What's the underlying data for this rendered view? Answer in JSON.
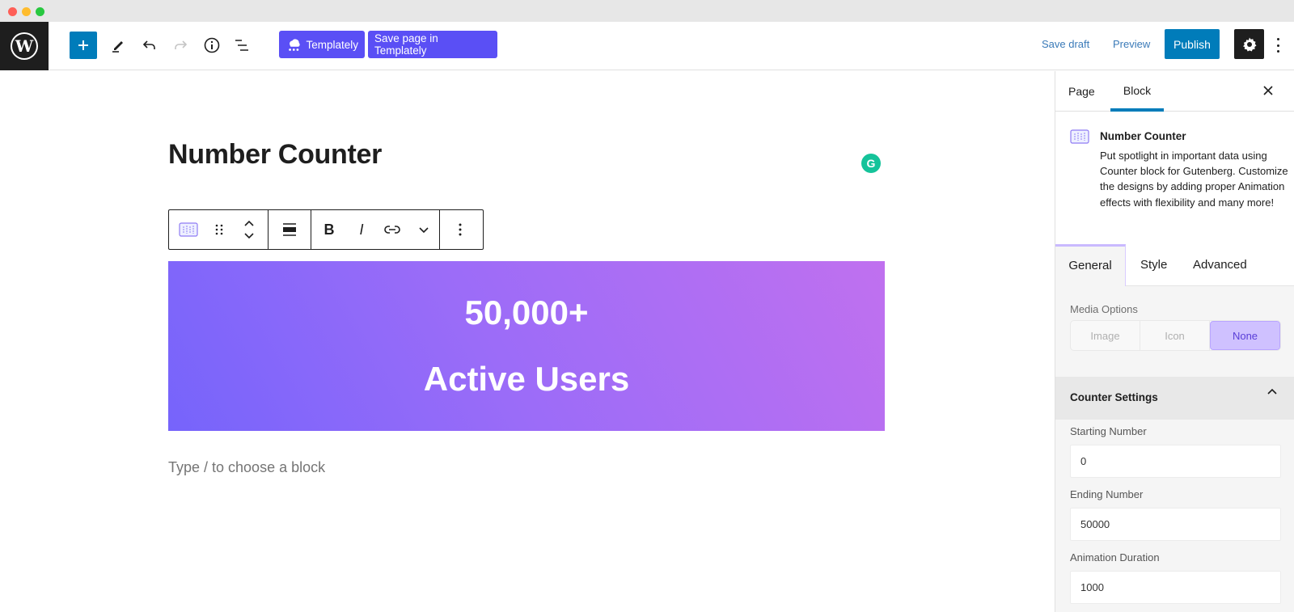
{
  "toolbar": {
    "templately_label": "Templately",
    "save_templately_label": "Save page in Templately",
    "save_draft_label": "Save draft",
    "preview_label": "Preview",
    "publish_label": "Publish",
    "icons": [
      "wordpress-logo",
      "plus-icon",
      "pencil-icon",
      "undo-icon",
      "redo-icon",
      "info-icon",
      "list-view-icon",
      "templately-icon",
      "gear-icon",
      "more-vertical-icon"
    ]
  },
  "editor": {
    "page_title": "Number Counter",
    "block_toolbar": {
      "bold_label": "B",
      "italic_label": "I"
    },
    "counter": {
      "number": "50,000+",
      "label": "Active Users",
      "gradient_start": "#7664fb",
      "gradient_end": "#c070ef"
    },
    "appender_placeholder": "Type / to choose a block"
  },
  "sidebar": {
    "tabs": [
      {
        "label": "Page",
        "active": false
      },
      {
        "label": "Block",
        "active": true
      }
    ],
    "block_card": {
      "title": "Number Counter",
      "description": "Put spotlight in important data using Counter block for Gutenberg. Customize the designs by adding proper Animation effects with flexibility and many more!"
    },
    "panel_tabs": [
      {
        "label": "General",
        "active": true
      },
      {
        "label": "Style",
        "active": false
      },
      {
        "label": "Advanced",
        "active": false
      }
    ],
    "media_options": {
      "label": "Media Options",
      "options": [
        "Image",
        "Icon",
        "None"
      ],
      "selected": "None"
    },
    "counter_settings": {
      "title": "Counter Settings",
      "expanded": true,
      "fields": [
        {
          "label": "Starting Number",
          "value": "0"
        },
        {
          "label": "Ending Number",
          "value": "50000"
        },
        {
          "label": "Animation Duration",
          "value": "1000"
        }
      ]
    }
  }
}
